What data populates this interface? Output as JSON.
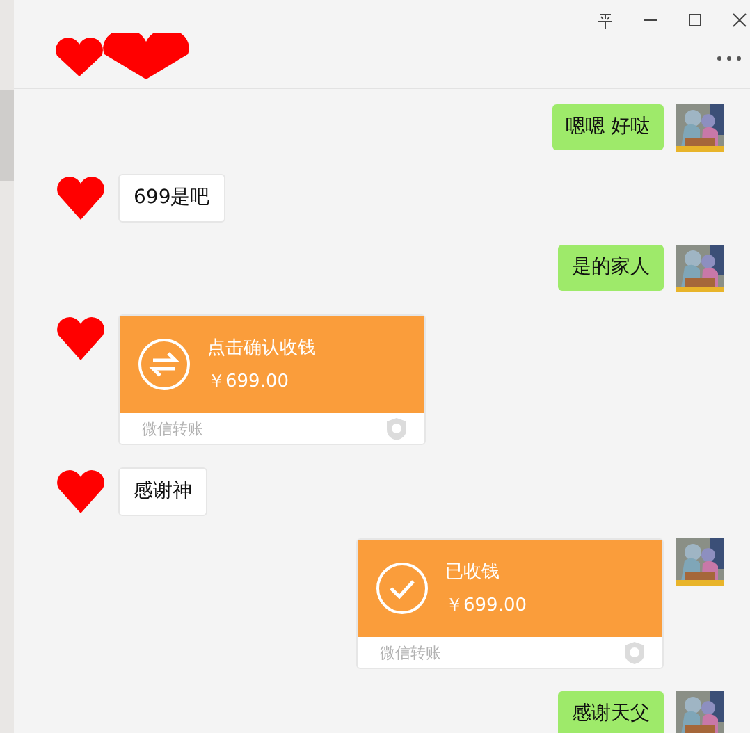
{
  "messages": [
    {
      "kind": "text",
      "outgoing": true,
      "text": "嗯嗯 好哒"
    },
    {
      "kind": "text",
      "outgoing": false,
      "text": "699是吧"
    },
    {
      "kind": "text",
      "outgoing": true,
      "text": "是的家人"
    },
    {
      "kind": "transfer",
      "outgoing": false,
      "received": false,
      "title": "点击确认收钱",
      "amount": "￥699.00",
      "footer": "微信转账"
    },
    {
      "kind": "text",
      "outgoing": false,
      "text": "感谢神"
    },
    {
      "kind": "transfer",
      "outgoing": true,
      "received": true,
      "title": "已收钱",
      "amount": "￥699.00",
      "footer": "微信转账"
    },
    {
      "kind": "text",
      "outgoing": true,
      "text": "感谢天父"
    }
  ]
}
